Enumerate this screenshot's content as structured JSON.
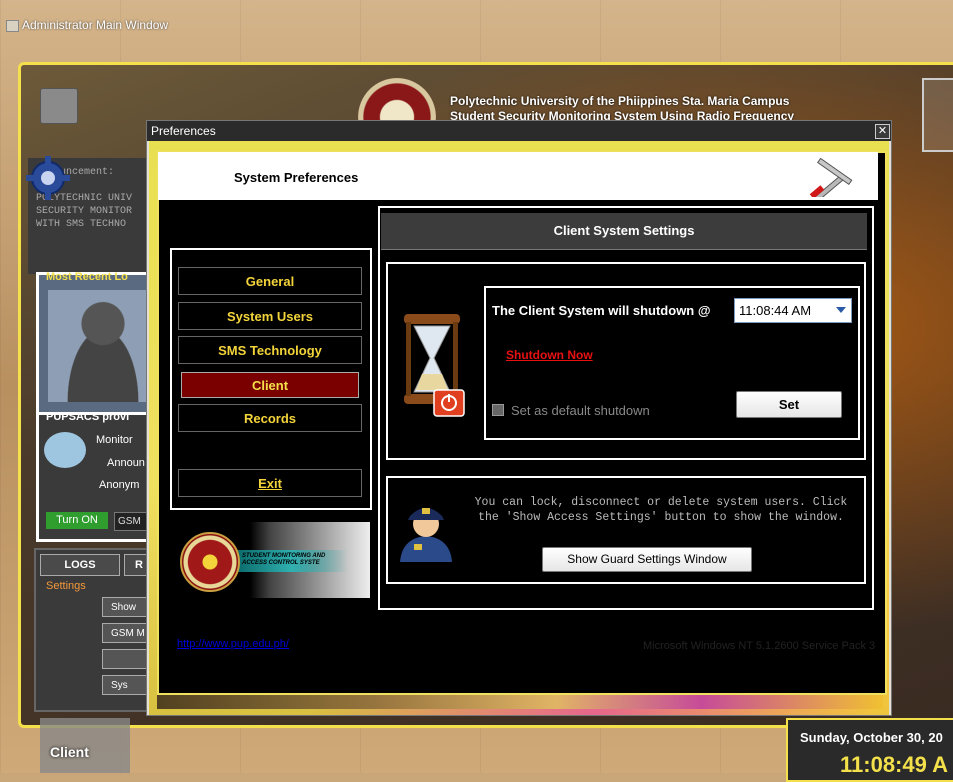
{
  "main_window": {
    "title": "Administrator Main Window",
    "header_line1": "Polytechnic University of the Phiippines Sta. Maria Campus",
    "header_line2": "Student Security Monitoring System Using Radio Frequency",
    "announcement": "Announcement:\n\nPOLYTECHNIC UNIV\nSECURITY MONITOR\nWITH SMS TECHNO",
    "most_recent_label": "Most Recent Lo",
    "pupsacs_label": "PUPSACS provi",
    "pupsacs_lines": [
      "Monitor",
      "Announ",
      "Anonym"
    ],
    "turn_on": "Turn ON",
    "gsm": "GSM",
    "logs": "LOGS",
    "r": "R",
    "settings": "Settings",
    "side_buttons": [
      "Show",
      "GSM M",
      "",
      "Sys"
    ],
    "client_tile": "Client",
    "date": "Sunday, October 30, 20",
    "clock": "11:08:49 A"
  },
  "dialog": {
    "title": "Preferences",
    "close": "✕",
    "header_title": "System Preferences",
    "nav": [
      {
        "label": "General",
        "active": false
      },
      {
        "label": "System Users",
        "active": false
      },
      {
        "label": "SMS Technology",
        "active": false
      },
      {
        "label": "Client",
        "active": true
      },
      {
        "label": "Records",
        "active": false
      }
    ],
    "exit": "Exit",
    "logo_text": "STUDENT MONITORING AND ACCESS CONTROL SYSTE",
    "panel_title": "Client System Settings",
    "shutdown_label": "The Client System will shutdown @",
    "shutdown_time": "11:08:44 AM",
    "shutdown_now": "Shutdown Now",
    "default_checkbox": "Set as default shutdown",
    "set_button": "Set",
    "guard_text": "You can lock, disconnect or delete system users. Click the 'Show Access Settings' button to show the window.",
    "guard_button": "Show Guard Settings Window",
    "footer_link": "http://www.pup.edu.ph/",
    "footer_os": "Microsoft Windows NT 5.1.2600 Service Pack 3"
  },
  "colors": {
    "accent_yellow": "#f3d43a",
    "active_nav": "#7a0000",
    "shutdown_red": "#e81010"
  }
}
